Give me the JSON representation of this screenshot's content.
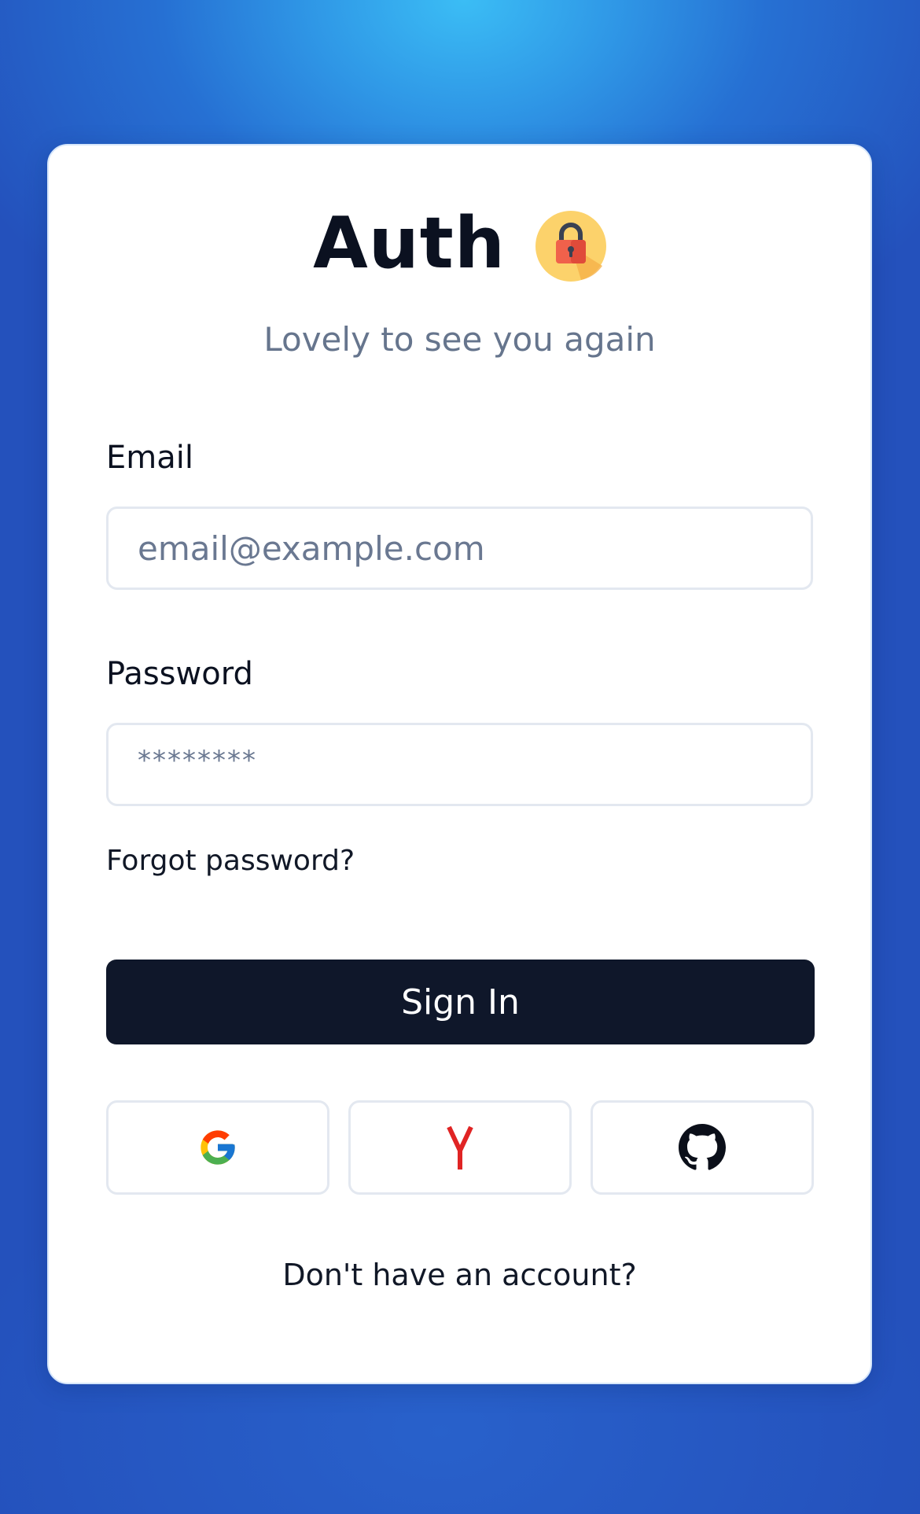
{
  "header": {
    "title": "Auth",
    "lock_icon": "padlock-icon",
    "subtitle": "Lovely to see you again"
  },
  "form": {
    "email_label": "Email",
    "email_placeholder": "email@example.com",
    "password_label": "Password",
    "password_value": "********",
    "forgot_link": "Forgot password?",
    "submit_label": "Sign In"
  },
  "social": {
    "providers": [
      {
        "name": "Google",
        "icon": "google-icon"
      },
      {
        "name": "Yandex",
        "icon": "yandex-icon"
      },
      {
        "name": "GitHub",
        "icon": "github-icon"
      }
    ]
  },
  "footer": {
    "signup_text": "Don't have an account?"
  },
  "colors": {
    "primary_button": "#0f172a",
    "lock_badge": "#fcd26b",
    "lock_body": "#f0614b",
    "yandex_red": "#e02424"
  }
}
